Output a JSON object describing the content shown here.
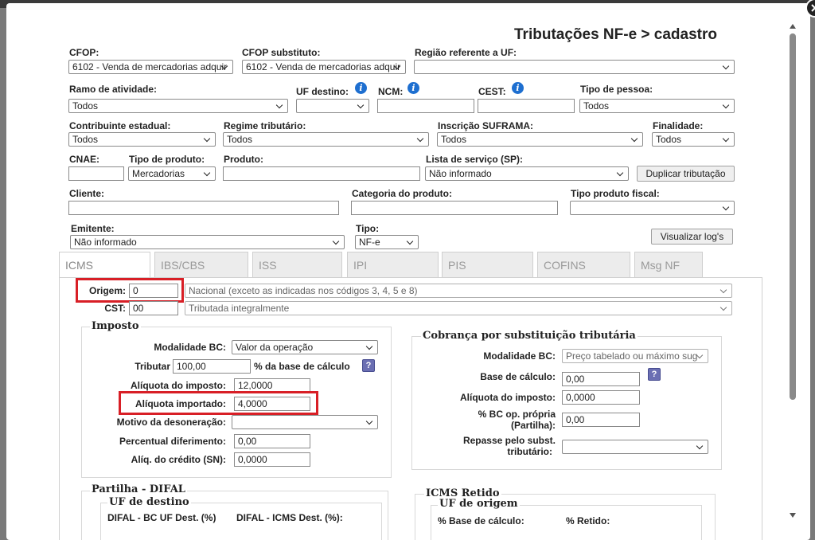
{
  "title": "Tributações NF-e > cadastro",
  "fields": {
    "cfop": {
      "label": "CFOP:",
      "value": "6102 - Venda de mercadorias adquir"
    },
    "cfop_sub": {
      "label": "CFOP substituto:",
      "value": "6102 - Venda de mercadorias adquir"
    },
    "regiao": {
      "label": "Região referente a UF:",
      "value": ""
    },
    "ramo": {
      "label": "Ramo de atividade:",
      "value": "Todos"
    },
    "uf_destino": {
      "label": "UF destino:",
      "value": ""
    },
    "ncm": {
      "label": "NCM:",
      "value": ""
    },
    "cest": {
      "label": "CEST:",
      "value": ""
    },
    "tipo_pessoa": {
      "label": "Tipo de pessoa:",
      "value": "Todos"
    },
    "contribuinte": {
      "label": "Contribuinte estadual:",
      "value": "Todos"
    },
    "regime": {
      "label": "Regime tributário:",
      "value": "Todos"
    },
    "suframa": {
      "label": "Inscrição SUFRAMA:",
      "value": "Todos"
    },
    "finalidade": {
      "label": "Finalidade:",
      "value": "Todos"
    },
    "cnae": {
      "label": "CNAE:",
      "value": ""
    },
    "tipo_produto": {
      "label": "Tipo de produto:",
      "value": "Mercadorias"
    },
    "produto": {
      "label": "Produto:",
      "value": ""
    },
    "lista_servico": {
      "label": "Lista de serviço (SP):",
      "value": "Não informado"
    },
    "cliente": {
      "label": "Cliente:",
      "value": ""
    },
    "categoria": {
      "label": "Categoria do produto:",
      "value": ""
    },
    "tipo_fiscal": {
      "label": "Tipo produto fiscal:",
      "value": ""
    },
    "emitente": {
      "label": "Emitente:",
      "value": "Não informado"
    },
    "tipo": {
      "label": "Tipo:",
      "value": "NF-e"
    }
  },
  "buttons": {
    "duplicar": "Duplicar tributação",
    "log": "Visualizar log's"
  },
  "tabs": [
    "ICMS",
    "IBS/CBS",
    "ISS",
    "IPI",
    "PIS",
    "COFINS",
    "Msg NF"
  ],
  "icms": {
    "origem": {
      "label": "Origem:",
      "code": "0",
      "desc": "Nacional (exceto as indicadas nos códigos 3, 4, 5 e 8)"
    },
    "cst": {
      "label": "CST:",
      "code": "00",
      "desc": "Tributada integralmente"
    },
    "imposto": {
      "legend": "Imposto",
      "modalidade_label": "Modalidade BC:",
      "modalidade": "Valor da operação",
      "tributar_label": "Tributar",
      "tributar": "100,00",
      "tributar_suffix": "% da base de cálculo",
      "aliquota_label": "Alíquota do imposto:",
      "aliquota": "12,0000",
      "importado_label": "Alíquota importado:",
      "importado": "4,0000",
      "motivo_label": "Motivo da desoneração:",
      "motivo": "",
      "diferimento_label": "Percentual diferimento:",
      "diferimento": "0,00",
      "credito_label": "Alíq. do crédito (SN):",
      "credito": "0,0000"
    },
    "st": {
      "legend": "Cobrança por substituição tributária",
      "modalidade_label": "Modalidade BC:",
      "modalidade": "Preço tabelado ou máximo sug",
      "base_label": "Base de cálculo:",
      "base": "0,00",
      "aliquota_label": "Alíquota do imposto:",
      "aliquota": "0,0000",
      "bc_propria_label1": "% BC op. própria",
      "bc_propria_label2": "(Partilha):",
      "bc_propria": "0,00",
      "repasse_label1": "Repasse pelo subst.",
      "repasse_label2": "tributário:",
      "repasse": ""
    },
    "difal": {
      "legend": "Partilha - DIFAL",
      "sub": "UF de destino",
      "col1": "DIFAL - BC UF Dest. (%)",
      "col2": "DIFAL - ICMS Dest. (%):"
    },
    "retido": {
      "legend": "ICMS Retido",
      "sub": "UF de origem",
      "col1": "% Base de cálculo:",
      "col2": "% Retido:"
    }
  },
  "colors": {
    "highlight": "#d81f26",
    "info_icon": "#1e6fd0",
    "help_icon": "#6b6fb3"
  }
}
